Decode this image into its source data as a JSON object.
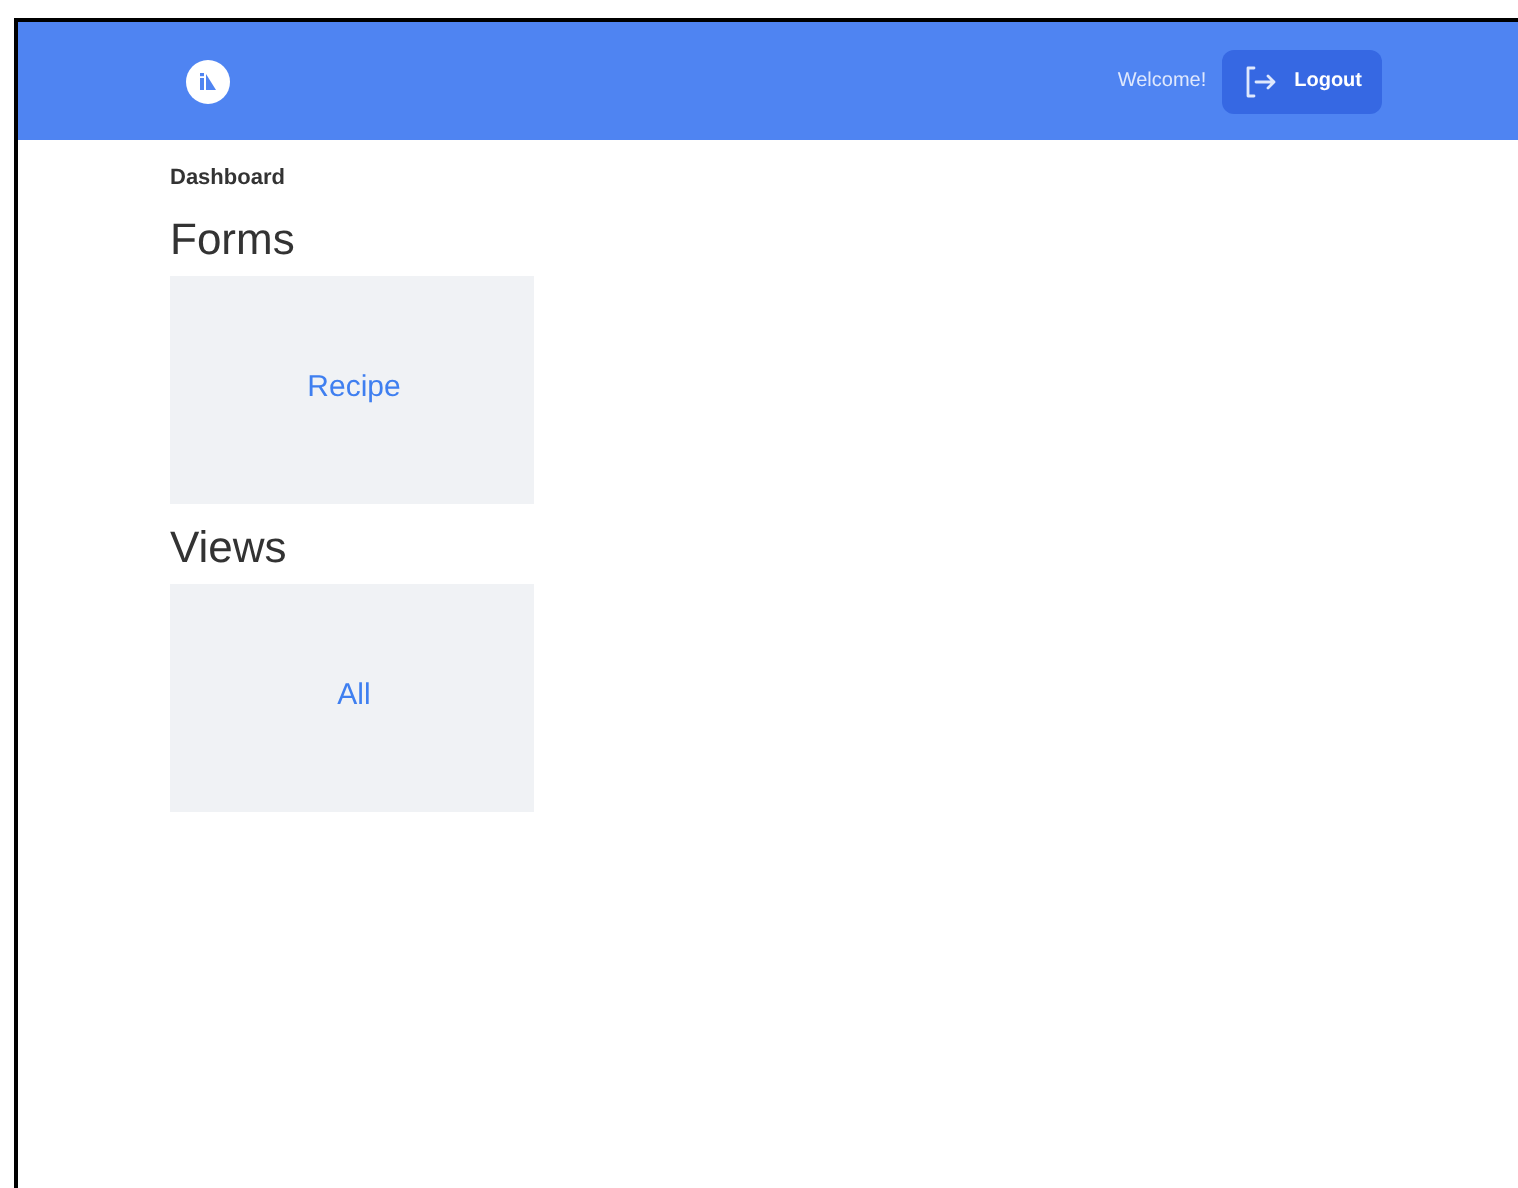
{
  "header": {
    "welcome": "Welcome!",
    "logout_button": "Logout"
  },
  "breadcrumb": "Dashboard",
  "sections": [
    {
      "title": "Forms",
      "cards": [
        "Recipe"
      ]
    },
    {
      "title": "Views",
      "cards": [
        "All"
      ]
    }
  ]
}
